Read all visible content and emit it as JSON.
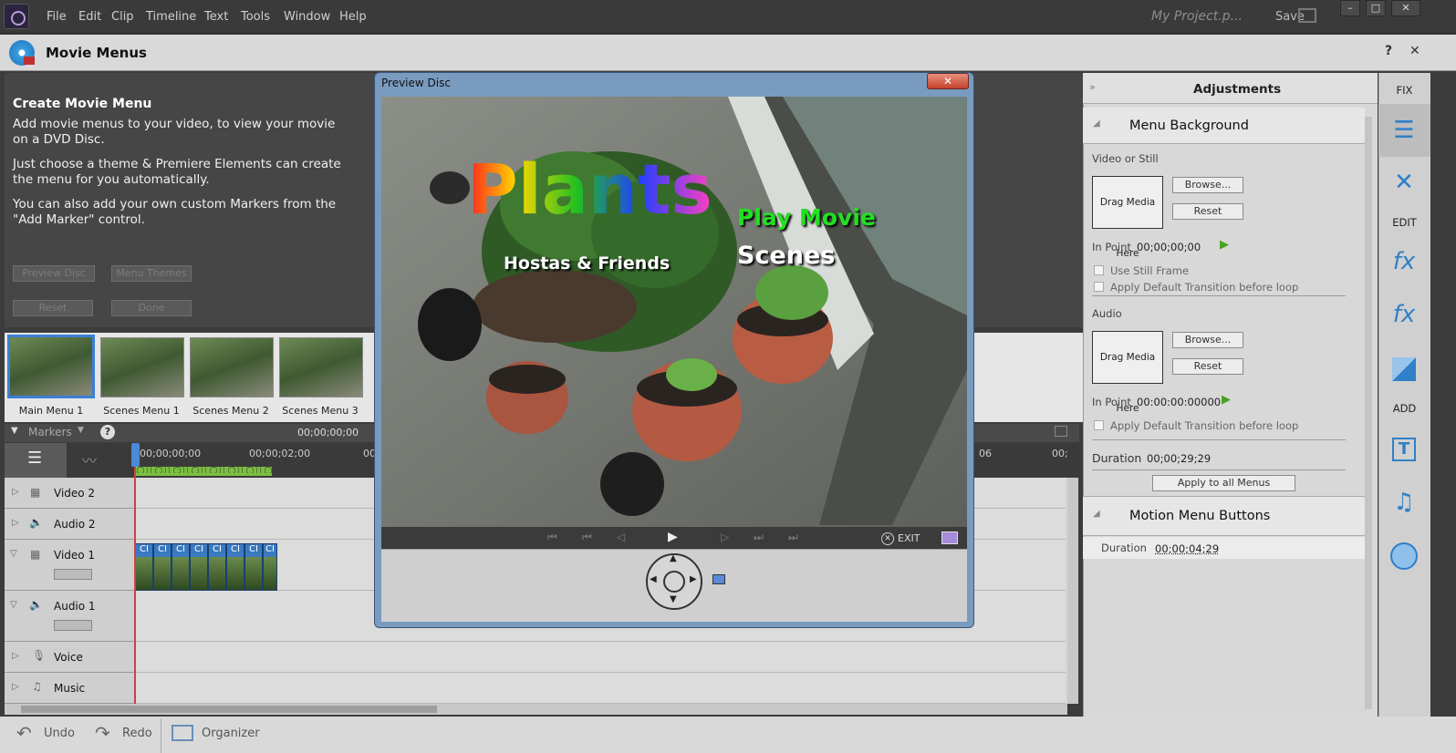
{
  "menubar": {
    "items": [
      "File",
      "Edit",
      "Clip",
      "Timeline",
      "Text",
      "Tools",
      "Window",
      "Help"
    ],
    "project_name": "My Project.p...",
    "save_label": "Save"
  },
  "panel": {
    "title": "Movie Menus",
    "help": "?",
    "close": "✕"
  },
  "create": {
    "heading": "Create Movie Menu",
    "para1": "Add movie menus to your video, to view your movie on a DVD Disc.",
    "para2": "Just choose a theme & Premiere Elements can create the menu for you automatically.",
    "para3": "You can also add your own custom Markers from the \"Add Marker\" control.",
    "btn_preview": "Preview Disc",
    "btn_themes": "Menu Themes",
    "btn_reset": "Reset",
    "btn_done": "Done"
  },
  "menus": [
    {
      "label": "Main Menu 1"
    },
    {
      "label": "Scenes Menu 1"
    },
    {
      "label": "Scenes Menu 2"
    },
    {
      "label": "Scenes Menu 3"
    }
  ],
  "timeline": {
    "markers_label": "Markers",
    "current_time": "00;00;00;00",
    "ruler_start": "00;00;00;00",
    "ruler_2": "00;00;02;00",
    "ruler_mid": "00",
    "ruler_right1": "06",
    "ruler_right2": "00;",
    "tracks": [
      "Video 2",
      "Audio 2",
      "Video 1",
      "Audio 1",
      "Voice",
      "Music"
    ],
    "clip_tag": "CI"
  },
  "dialog": {
    "title": "Preview Disc",
    "close": "✕",
    "menu_title": "Plants",
    "menu_subtitle": "Hostas & Friends",
    "play_movie": "Play Movie",
    "scenes": "Scenes",
    "exit_label": "EXIT"
  },
  "adjustments": {
    "title": "Adjustments",
    "bg_section": "Menu Background",
    "video_or_still": "Video or Still",
    "drag_media": "Drag Media Here",
    "browse": "Browse...",
    "reset": "Reset",
    "in_point_label": "In Point",
    "video_in_point": "00;00;00;00",
    "use_still": "Use Still Frame",
    "apply_transition": "Apply Default Transition before loop",
    "audio_label": "Audio",
    "audio_in_point": "00:00:00:00000",
    "duration_label": "Duration",
    "duration_value": "00;00;29;29",
    "apply_all": "Apply to all Menus",
    "motion_section": "Motion Menu Buttons",
    "motion_duration": "00;00;04;29"
  },
  "toolrail": {
    "fix": "FIX",
    "edit": "EDIT",
    "add": "ADD"
  },
  "bottom": {
    "undo": "Undo",
    "redo": "Redo",
    "organizer": "Organizer"
  }
}
